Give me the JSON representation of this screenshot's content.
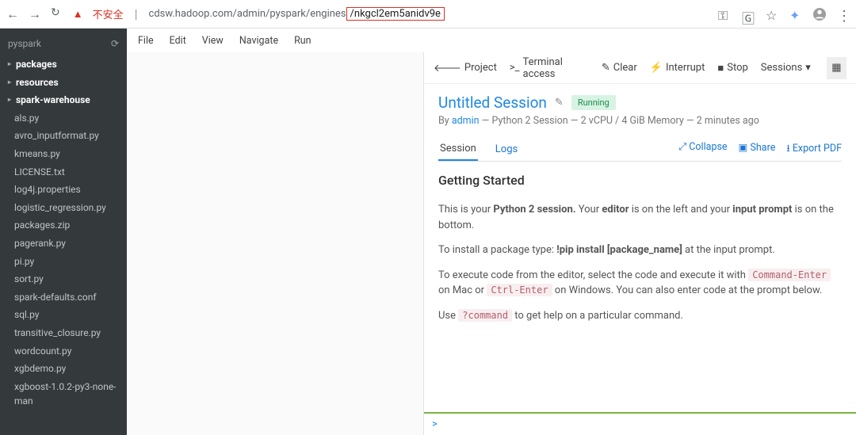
{
  "browser": {
    "insecure_label": "不安全",
    "url_prefix": "cdsw.hadoop.com/admin/pyspark/engines",
    "url_highlighted": "/nkgcl2em5anidv9e"
  },
  "sidebar": {
    "project": "pyspark",
    "folders": [
      {
        "label": "packages"
      },
      {
        "label": "resources"
      },
      {
        "label": "spark-warehouse"
      }
    ],
    "files": [
      "als.py",
      "avro_inputformat.py",
      "kmeans.py",
      "LICENSE.txt",
      "log4j.properties",
      "logistic_regression.py",
      "packages.zip",
      "pagerank.py",
      "pi.py",
      "sort.py",
      "spark-defaults.conf",
      "sql.py",
      "transitive_closure.py",
      "wordcount.py",
      "xgbdemo.py",
      "xgboost-1.0.2-py3-none-man"
    ]
  },
  "editor_menu": [
    "File",
    "Edit",
    "View",
    "Navigate",
    "Run"
  ],
  "session_toolbar": {
    "project": "Project",
    "terminal": "Terminal access",
    "clear": "Clear",
    "interrupt": "Interrupt",
    "stop": "Stop",
    "sessions": "Sessions"
  },
  "session": {
    "title": "Untitled Session",
    "status": "Running",
    "by": "By ",
    "user": "admin",
    "meta": " — Python 2 Session — 2 vCPU / 4 GiB Memory — 2 minutes ago",
    "tabs": {
      "session": "Session",
      "logs": "Logs"
    },
    "actions": {
      "collapse": "Collapse",
      "share": "Share",
      "export": "Export PDF"
    },
    "getting_started": "Getting Started",
    "p1_a": "This is your ",
    "p1_b": "Python 2 session.",
    "p1_c": " Your ",
    "p1_d": "editor",
    "p1_e": " is on the left and your ",
    "p1_f": "input prompt",
    "p1_g": " is on the bottom.",
    "p2_a": "To install a package type: ",
    "p2_b": "!pip install [package_name]",
    "p2_c": " at the input prompt.",
    "p3_a": "To execute code from the editor, select the code and execute it with ",
    "p3_b": "Command-Enter",
    "p3_c": " on Mac or ",
    "p3_d": "Ctrl-Enter",
    "p3_e": " on Windows. You can also enter code at the prompt below.",
    "p4_a": "Use ",
    "p4_b": "?command",
    "p4_c": " to get help on a particular command."
  },
  "prompt": ">"
}
